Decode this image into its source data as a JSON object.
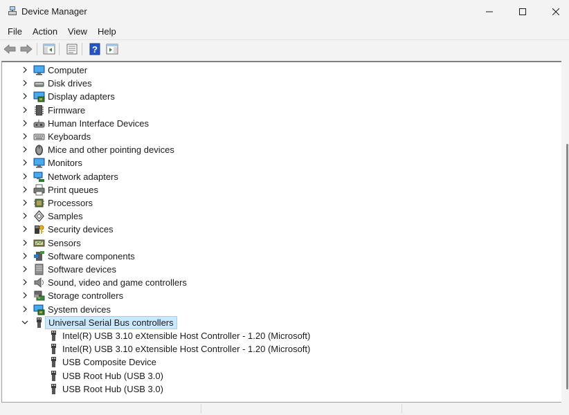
{
  "window": {
    "title": "Device Manager"
  },
  "menu": [
    "File",
    "Action",
    "View",
    "Help"
  ],
  "tree": [
    {
      "label": "Computer",
      "icon": "computer-icon",
      "expanded": false,
      "level": 0
    },
    {
      "label": "Disk drives",
      "icon": "disk-drive-icon",
      "expanded": false,
      "level": 0
    },
    {
      "label": "Display adapters",
      "icon": "display-adapter-icon",
      "expanded": false,
      "level": 0
    },
    {
      "label": "Firmware",
      "icon": "firmware-icon",
      "expanded": false,
      "level": 0
    },
    {
      "label": "Human Interface Devices",
      "icon": "hid-icon",
      "expanded": false,
      "level": 0
    },
    {
      "label": "Keyboards",
      "icon": "keyboard-icon",
      "expanded": false,
      "level": 0
    },
    {
      "label": "Mice and other pointing devices",
      "icon": "mouse-icon",
      "expanded": false,
      "level": 0
    },
    {
      "label": "Monitors",
      "icon": "monitor-icon",
      "expanded": false,
      "level": 0
    },
    {
      "label": "Network adapters",
      "icon": "network-adapter-icon",
      "expanded": false,
      "level": 0
    },
    {
      "label": "Print queues",
      "icon": "printer-icon",
      "expanded": false,
      "level": 0
    },
    {
      "label": "Processors",
      "icon": "processor-icon",
      "expanded": false,
      "level": 0
    },
    {
      "label": "Samples",
      "icon": "samples-icon",
      "expanded": false,
      "level": 0
    },
    {
      "label": "Security devices",
      "icon": "security-device-icon",
      "expanded": false,
      "level": 0
    },
    {
      "label": "Sensors",
      "icon": "sensor-icon",
      "expanded": false,
      "level": 0
    },
    {
      "label": "Software components",
      "icon": "software-component-icon",
      "expanded": false,
      "level": 0
    },
    {
      "label": "Software devices",
      "icon": "software-device-icon",
      "expanded": false,
      "level": 0
    },
    {
      "label": "Sound, video and game controllers",
      "icon": "speaker-icon",
      "expanded": false,
      "level": 0
    },
    {
      "label": "Storage controllers",
      "icon": "storage-controller-icon",
      "expanded": false,
      "level": 0
    },
    {
      "label": "System devices",
      "icon": "system-device-icon",
      "expanded": false,
      "level": 0
    },
    {
      "label": "Universal Serial Bus controllers",
      "icon": "usb-icon",
      "expanded": true,
      "selected": true,
      "level": 0
    },
    {
      "label": "Intel(R) USB 3.10 eXtensible Host Controller - 1.20 (Microsoft)",
      "icon": "usb-plug-icon",
      "level": 1
    },
    {
      "label": "Intel(R) USB 3.10 eXtensible Host Controller - 1.20 (Microsoft)",
      "icon": "usb-plug-icon",
      "level": 1
    },
    {
      "label": "USB Composite Device",
      "icon": "usb-plug-icon",
      "level": 1
    },
    {
      "label": "USB Root Hub (USB 3.0)",
      "icon": "usb-plug-icon",
      "level": 1
    },
    {
      "label": "USB Root Hub (USB 3.0)",
      "icon": "usb-plug-icon",
      "level": 1
    }
  ]
}
